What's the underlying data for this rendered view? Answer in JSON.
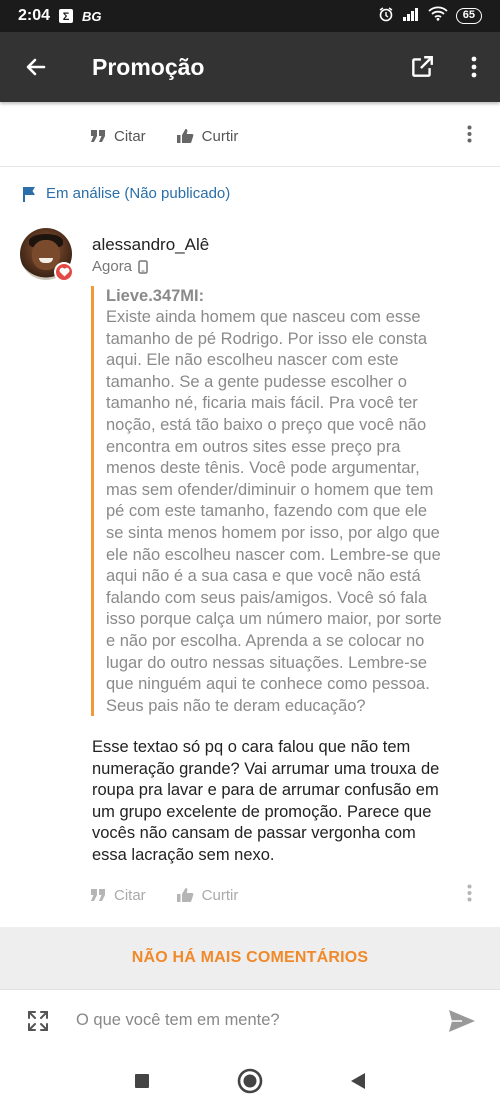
{
  "status_bar": {
    "time": "2:04",
    "carrier_label": "BG",
    "battery": "65"
  },
  "app_bar": {
    "title": "Promoção"
  },
  "previous_comment": {
    "cite_label": "Citar",
    "like_label": "Curtir"
  },
  "moderation": {
    "status_text": "Em análise (Não publicado)"
  },
  "comment": {
    "username": "alessandro_Alê",
    "time": "Agora",
    "quote": {
      "author": "Lieve.347MI:",
      "lines": [
        "Existe ainda homem que nasceu com esse",
        "tamanho de pé Rodrigo. Por isso ele consta",
        "aqui. Ele não escolheu nascer com este",
        "tamanho. Se a gente pudesse escolher o",
        "tamanho né, ficaria mais fácil. Pra você ter",
        "noção, está tão baixo o preço que você não",
        "encontra em outros sites esse preço pra",
        "menos deste tênis. Você pode argumentar,",
        "mas sem ofender/diminuir o homem que tem",
        "pé com este tamanho, fazendo com que ele",
        "se sinta menos homem por isso, por algo que",
        "ele não escolheu nascer com. Lembre-se que",
        "aqui não é a sua casa e que você não está",
        "falando com seus pais/amigos. Você só fala",
        "isso porque calça um número maior, por sorte",
        "e não por escolha. Aprenda a se colocar no",
        "lugar do outro nessas situações. Lembre-se",
        "que ninguém aqui te conhece como pessoa.",
        "Seus pais não te deram educação?"
      ]
    },
    "reply_lines": [
      "Esse textao só pq o cara falou que não tem",
      "numeração grande? Vai arrumar uma trouxa de",
      "roupa pra lavar e para de arrumar confusão em",
      "um grupo excelente de promoção. Parece que",
      "vocês não cansam de passar vergonha com",
      "essa lacração sem nexo."
    ],
    "cite_label": "Citar",
    "like_label": "Curtir"
  },
  "footer": {
    "no_more_comments": "NÃO HÁ MAIS COMENTÁRIOS"
  },
  "composer": {
    "placeholder": "O que você tem em mente?"
  },
  "colors": {
    "accent_orange": "#f0892a",
    "quote_bar": "#f29a3a",
    "status_blue": "#2a6fa8",
    "app_bar": "#333333"
  }
}
